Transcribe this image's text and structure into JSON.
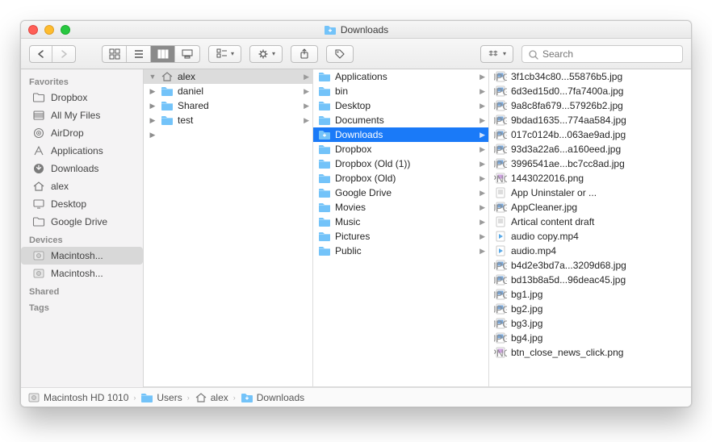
{
  "window": {
    "title": "Downloads"
  },
  "toolbar": {
    "search_placeholder": "Search"
  },
  "sidebar": {
    "sections": [
      {
        "title": "Favorites",
        "items": [
          {
            "icon": "folder",
            "label": "Dropbox"
          },
          {
            "icon": "allfiles",
            "label": "All My Files"
          },
          {
            "icon": "airdrop",
            "label": "AirDrop"
          },
          {
            "icon": "apps",
            "label": "Applications"
          },
          {
            "icon": "download",
            "label": "Downloads"
          },
          {
            "icon": "home",
            "label": "alex"
          },
          {
            "icon": "desktop",
            "label": "Desktop"
          },
          {
            "icon": "folder",
            "label": "Google Drive"
          }
        ]
      },
      {
        "title": "Devices",
        "items": [
          {
            "icon": "disk",
            "label": "Macintosh...",
            "selected": true
          },
          {
            "icon": "disk",
            "label": "Macintosh..."
          }
        ]
      },
      {
        "title": "Shared",
        "items": []
      },
      {
        "title": "Tags",
        "items": []
      }
    ]
  },
  "columns": [
    {
      "items": [
        {
          "icon": "home",
          "label": "alex",
          "selected": "gray",
          "expandable": true,
          "expanded": true
        },
        {
          "icon": "folder",
          "label": "daniel",
          "expandable": true
        },
        {
          "icon": "folder",
          "label": "Shared",
          "expandable": true
        },
        {
          "icon": "folder",
          "label": "test",
          "expandable": true
        }
      ],
      "more": true
    },
    {
      "items": [
        {
          "icon": "folder",
          "label": "Applications",
          "expandable": true
        },
        {
          "icon": "folder",
          "label": "bin",
          "expandable": true
        },
        {
          "icon": "folder",
          "label": "Desktop",
          "expandable": true
        },
        {
          "icon": "folder",
          "label": "Documents",
          "expandable": true
        },
        {
          "icon": "folder-dl",
          "label": "Downloads",
          "selected": "blue",
          "expandable": true
        },
        {
          "icon": "folder",
          "label": "Dropbox",
          "expandable": true
        },
        {
          "icon": "folder",
          "label": "Dropbox (Old (1))",
          "expandable": true
        },
        {
          "icon": "folder",
          "label": "Dropbox (Old)",
          "expandable": true
        },
        {
          "icon": "folder",
          "label": "Google Drive",
          "expandable": true
        },
        {
          "icon": "folder",
          "label": "Movies",
          "expandable": true
        },
        {
          "icon": "folder",
          "label": "Music",
          "expandable": true
        },
        {
          "icon": "folder",
          "label": "Pictures",
          "expandable": true
        },
        {
          "icon": "folder",
          "label": "Public",
          "expandable": true
        }
      ]
    },
    {
      "items": [
        {
          "icon": "jpg",
          "label": "3f1cb34c80...55876b5.jpg"
        },
        {
          "icon": "jpg",
          "label": "6d3ed15d0...7fa7400a.jpg"
        },
        {
          "icon": "jpg",
          "label": "9a8c8fa679...57926b2.jpg"
        },
        {
          "icon": "jpg",
          "label": "9bdad1635...774aa584.jpg"
        },
        {
          "icon": "jpg",
          "label": "017c0124b...063ae9ad.jpg"
        },
        {
          "icon": "jpg",
          "label": "93d3a22a6...a160eed.jpg"
        },
        {
          "icon": "jpg",
          "label": "3996541ae...bc7cc8ad.jpg"
        },
        {
          "icon": "png",
          "label": "1443022016.png"
        },
        {
          "icon": "txt",
          "label": "App Uninstaler or ..."
        },
        {
          "icon": "jpg",
          "label": "AppCleaner.jpg"
        },
        {
          "icon": "txt",
          "label": "Artical content draft"
        },
        {
          "icon": "mp4",
          "label": "audio copy.mp4"
        },
        {
          "icon": "mp4",
          "label": "audio.mp4"
        },
        {
          "icon": "jpg",
          "label": "b4d2e3bd7a...3209d68.jpg"
        },
        {
          "icon": "jpg",
          "label": "bd13b8a5d...96deac45.jpg"
        },
        {
          "icon": "jpg",
          "label": "bg1.jpg"
        },
        {
          "icon": "jpg",
          "label": "bg2.jpg"
        },
        {
          "icon": "jpg",
          "label": "bg3.jpg"
        },
        {
          "icon": "jpg",
          "label": "bg4.jpg"
        },
        {
          "icon": "png",
          "label": "btn_close_news_click.png"
        }
      ]
    }
  ],
  "breadcrumb": [
    {
      "icon": "disk",
      "label": "Macintosh HD 1010"
    },
    {
      "icon": "folder",
      "label": "Users"
    },
    {
      "icon": "home",
      "label": "alex"
    },
    {
      "icon": "folder-dl",
      "label": "Downloads"
    }
  ]
}
